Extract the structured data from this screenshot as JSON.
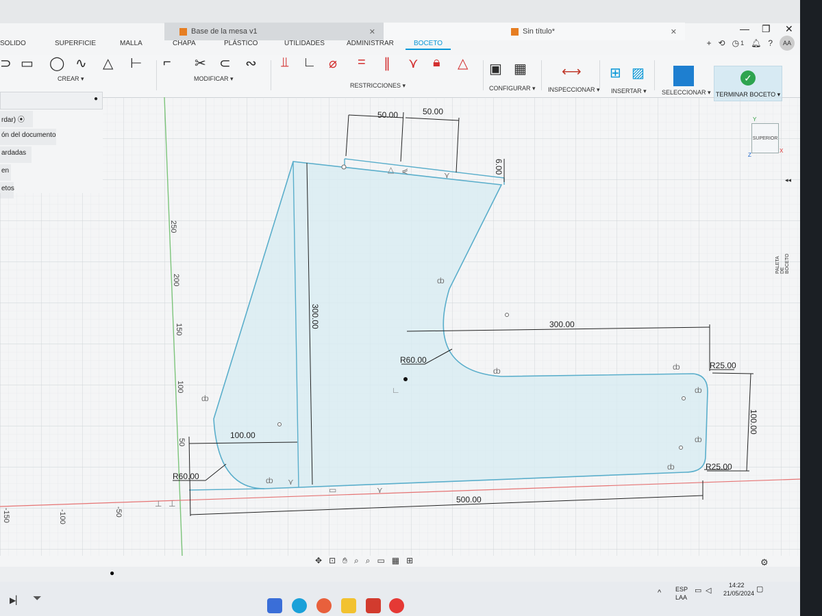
{
  "tabs": [
    {
      "label": "Base de la mesa v1"
    },
    {
      "label": "Sin título*"
    }
  ],
  "workspace_tabs": [
    "SOLIDO",
    "SUPERFICIE",
    "MALLA",
    "CHAPA",
    "PLÁSTICO",
    "UTILIDADES",
    "ADMINISTRAR",
    "BOCETO"
  ],
  "groups": {
    "crear": "CREAR ▾",
    "modificar": "MODIFICAR ▾",
    "restricciones": "RESTRICCIONES ▾",
    "configurar": "CONFIGURAR ▾",
    "inspeccionar": "INSPECCIONAR ▾",
    "insertar": "INSERTAR ▾",
    "seleccionar": "SELECCIONAR ▾",
    "terminar": "TERMINAR BOCETO ▾"
  },
  "header_right": {
    "job_count": "1",
    "user_initials": "AA"
  },
  "browser": {
    "items": [
      "rdar)",
      "ón del documento",
      "ardadas",
      "en",
      "etos"
    ]
  },
  "viewcube": {
    "face": "SUPERIOR",
    "x_axis": "X",
    "y_axis": "Y",
    "z_axis": "Z"
  },
  "sketch_palette": "PALETA DE BOCETO",
  "axis_labels": {
    "y": [
      "250",
      "200",
      "150",
      "100",
      "50"
    ],
    "x": [
      "-150",
      "-100",
      "-50"
    ]
  },
  "dimensions": {
    "top_left_width": "50.00",
    "top_right_width": "50.00",
    "top_offset": "6.00",
    "height": "300.00",
    "arm_length": "300.00",
    "inner_radius": "R60.00",
    "foot_height": "100.00",
    "outer_radius_top": "R25.00",
    "outer_radius_bottom": "R25.00",
    "bottom_left_width": "100.00",
    "bottom_left_radius": "R60.00",
    "total_width": "500.00"
  },
  "colors": {
    "sketch_line": "#5aaecb",
    "sketch_fill": "#d8ecf2",
    "accent": "#0696d7",
    "finish": "#2ea44f"
  },
  "taskbar": {
    "lang": "ESP",
    "lang2": "LAA",
    "time": "14:22",
    "date": "21/05/2024"
  }
}
